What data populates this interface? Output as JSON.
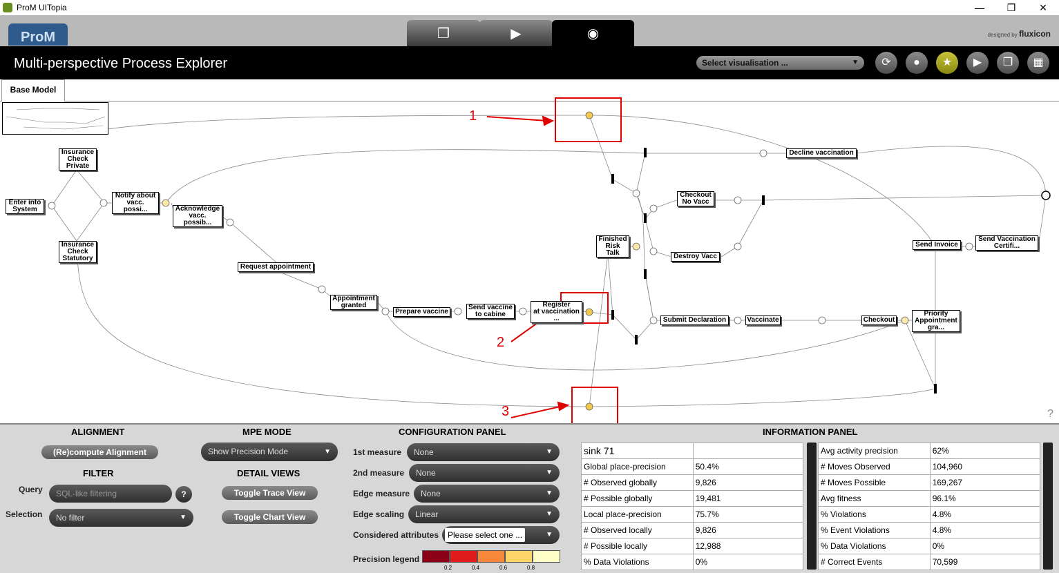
{
  "window": {
    "title": "ProM UITopia",
    "minimize": "—",
    "maximize": "❐",
    "close": "✕"
  },
  "header": {
    "logo": "ProM",
    "brand_prefix": "designed by",
    "brand_name": "fluxicon",
    "tabs": [
      {
        "name": "workspace",
        "icon": "❐"
      },
      {
        "name": "actions",
        "icon": "▶"
      },
      {
        "name": "views",
        "icon": "◉"
      }
    ]
  },
  "toolbar": {
    "title": "Multi-perspective Process Explorer",
    "select_visualisation": "Select visualisation ...",
    "buttons": [
      {
        "name": "refresh-icon",
        "glyph": "⟳"
      },
      {
        "name": "drop-icon",
        "glyph": "●"
      },
      {
        "name": "star-icon",
        "glyph": "★"
      },
      {
        "name": "play-icon",
        "glyph": "▶"
      },
      {
        "name": "copy-icon",
        "glyph": "❐"
      },
      {
        "name": "grid-icon",
        "glyph": "▦"
      }
    ]
  },
  "tabs": {
    "base_model": "Base Model"
  },
  "model": {
    "nodes": [
      {
        "id": "enter",
        "label": "Enter into\nSystem"
      },
      {
        "id": "ins_private",
        "label": "Insurance\nCheck\nPrivate"
      },
      {
        "id": "ins_statutory",
        "label": "Insurance\nCheck\nStatutory"
      },
      {
        "id": "notify",
        "label": "Notify about\nvacc.\npossi..."
      },
      {
        "id": "ack",
        "label": "Acknowledge\nvacc.\npossib..."
      },
      {
        "id": "request",
        "label": "Request appointment"
      },
      {
        "id": "granted",
        "label": "Appointment\ngranted"
      },
      {
        "id": "prepare",
        "label": "Prepare vaccine"
      },
      {
        "id": "send_cabine",
        "label": "Send vaccine\nto cabine"
      },
      {
        "id": "register",
        "label": "Register\nat vaccination\n..."
      },
      {
        "id": "risk",
        "label": "Finished\nRisk\nTalk"
      },
      {
        "id": "decline",
        "label": "Decline vaccination"
      },
      {
        "id": "checkout_no",
        "label": "Checkout\nNo Vacc"
      },
      {
        "id": "destroy",
        "label": "Destroy Vacc"
      },
      {
        "id": "submit",
        "label": "Submit Declaration"
      },
      {
        "id": "vaccinate",
        "label": "Vaccinate"
      },
      {
        "id": "checkout",
        "label": "Checkout"
      },
      {
        "id": "priority",
        "label": "Priority\nAppointment\ngra..."
      },
      {
        "id": "send_invoice",
        "label": "Send Invoice"
      },
      {
        "id": "send_cert",
        "label": "Send Vaccination\nCertifi..."
      }
    ],
    "annotations": [
      "1",
      "2",
      "3"
    ],
    "help": "?"
  },
  "colors": {
    "place_highlight": "#f2c94c",
    "place_light": "#fbe9a8",
    "annotation": "#e00000"
  },
  "alignment": {
    "title": "ALIGNMENT",
    "recompute": "(Re)compute Alignment"
  },
  "filter": {
    "title": "FILTER",
    "query_label": "Query",
    "query_placeholder": "SQL-like filtering",
    "help": "?",
    "selection_label": "Selection",
    "selection_value": "No filter"
  },
  "mpe_mode": {
    "title": "MPE MODE",
    "value": "Show Precision Mode"
  },
  "detail_views": {
    "title": "DETAIL VIEWS",
    "trace": "Toggle Trace View",
    "chart": "Toggle Chart View"
  },
  "config": {
    "title": "CONFIGURATION PANEL",
    "rows": [
      {
        "label": "1st measure",
        "value": "None"
      },
      {
        "label": "2nd measure",
        "value": "None"
      },
      {
        "label": "Edge measure",
        "value": "None"
      },
      {
        "label": "Edge scaling",
        "value": "Linear"
      },
      {
        "label": "Considered attributes",
        "value": "Please select one ..."
      }
    ],
    "legend_label": "Precision legend",
    "legend_colors": [
      "#8b0016",
      "#e01b1b",
      "#f7873a",
      "#fdd467",
      "#ffffc7"
    ],
    "legend_ticks": [
      "0.2",
      "0.4",
      "0.6",
      "0.8"
    ]
  },
  "info": {
    "title": "INFORMATION PANEL",
    "left": [
      [
        "sink 71",
        ""
      ],
      [
        "Global place-precision",
        "50.4%"
      ],
      [
        "# Observed globally",
        "9,826"
      ],
      [
        "# Possible globally",
        "19,481"
      ],
      [
        "Local place-precision",
        "75.7%"
      ],
      [
        "# Observed locally",
        "9,826"
      ],
      [
        "# Possible locally",
        "12,988"
      ],
      [
        "% Data Violations",
        "0%"
      ]
    ],
    "right": [
      [
        "Avg activity precision",
        "62%"
      ],
      [
        "# Moves Observed",
        "104,960"
      ],
      [
        "# Moves Possible",
        "169,267"
      ],
      [
        "Avg fitness",
        "96.1%"
      ],
      [
        "% Violations",
        "4.8%"
      ],
      [
        "% Event Violations",
        "4.8%"
      ],
      [
        "% Data Violations",
        "0%"
      ],
      [
        "# Correct Events",
        "70,599"
      ]
    ]
  }
}
